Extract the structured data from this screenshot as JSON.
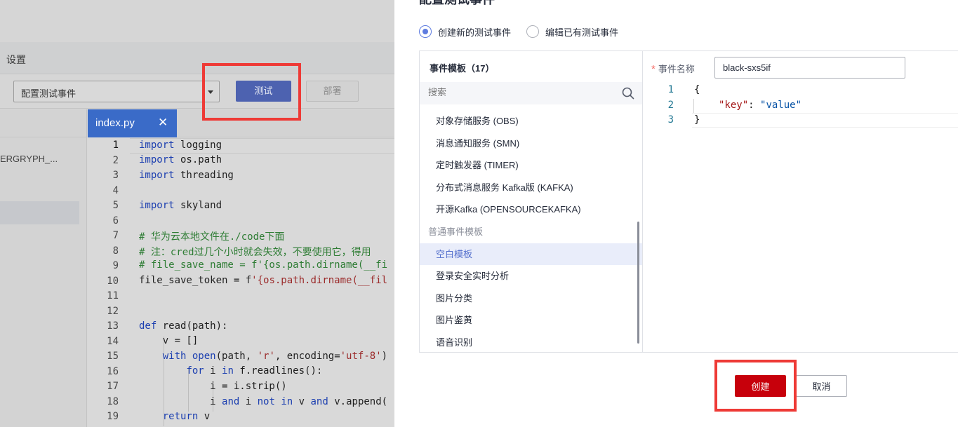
{
  "background": {
    "settings_label": "设置",
    "toolbar": {
      "event_select_value": "配置测试事件",
      "test_label": "测试",
      "deploy_label": "部署"
    },
    "sidebar_file": "ERGRYPH_...",
    "editor_tab": {
      "label": "index.py",
      "close": "✕"
    },
    "line_numbers": [
      "1",
      "2",
      "3",
      "4",
      "5",
      "6",
      "7",
      "8",
      "9",
      "10",
      "11",
      "12",
      "13",
      "14",
      "15",
      "16",
      "17",
      "18",
      "19"
    ]
  },
  "drawer": {
    "title": "配置测试事件",
    "mode_options": [
      {
        "label": "创建新的测试事件",
        "selected": true
      },
      {
        "label": "编辑已有测试事件",
        "selected": false
      }
    ],
    "templates": {
      "heading": "事件模板（17）",
      "search_placeholder": "搜索",
      "items": [
        {
          "label": "对象存储服务 (OBS)",
          "type": "item"
        },
        {
          "label": "消息通知服务 (SMN)",
          "type": "item"
        },
        {
          "label": "定时触发器 (TIMER)",
          "type": "item"
        },
        {
          "label": "分布式消息服务 Kafka版 (KAFKA)",
          "type": "item"
        },
        {
          "label": "开源Kafka (OPENSOURCEKAFKA)",
          "type": "item"
        },
        {
          "label": "普通事件模板",
          "type": "group"
        },
        {
          "label": "空白模板",
          "type": "item",
          "selected": true
        },
        {
          "label": "登录安全实时分析",
          "type": "item"
        },
        {
          "label": "图片分类",
          "type": "item"
        },
        {
          "label": "图片鉴黄",
          "type": "item"
        },
        {
          "label": "语音识别",
          "type": "item"
        }
      ]
    },
    "event_name": {
      "required_mark": "*",
      "label": "事件名称",
      "value": "black-sxs5if"
    },
    "json_editor": {
      "line_numbers": [
        "1",
        "2",
        "3"
      ],
      "open_brace": "{",
      "key": "\"key\"",
      "colon": ": ",
      "value": "\"value\"",
      "close_brace": "}"
    },
    "buttons": {
      "create": "创建",
      "cancel": "取消"
    }
  },
  "colors": {
    "accent": "#5e7ce0",
    "primary_button": "#c7000b",
    "highlight_box": "#ee3a36"
  }
}
